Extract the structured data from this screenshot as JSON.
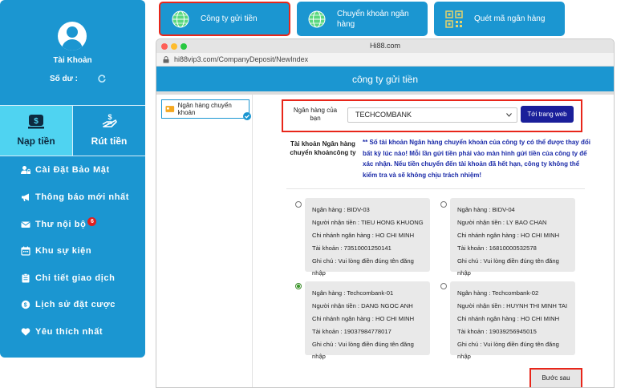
{
  "sidebar": {
    "account_label": "Tài Khoản",
    "balance_label": "Số dư :",
    "deposit_tab": "Nạp tiền",
    "withdraw_tab": "Rút tiền",
    "menu": [
      {
        "label": "Cài Đặt Bảo Mật",
        "icon": "user-lock-icon"
      },
      {
        "label": "Thông báo mới nhất",
        "icon": "megaphone-icon"
      },
      {
        "label": "Thư nội bộ",
        "icon": "envelope-icon",
        "badge": "6"
      },
      {
        "label": "Khu sự kiện",
        "icon": "calendar-icon"
      },
      {
        "label": "Chi tiết giao dịch",
        "icon": "clipboard-icon"
      },
      {
        "label": "Lịch sử đặt cược",
        "icon": "history-icon"
      },
      {
        "label": "Yêu thích nhất",
        "icon": "heart-icon"
      }
    ]
  },
  "methods": [
    {
      "label": "Công ty gửi tiền",
      "icon": "globe-icon",
      "selected": true
    },
    {
      "label": "Chuyển khoản ngân hàng",
      "icon": "globe-icon",
      "selected": false
    },
    {
      "label": "Quét mã ngân hàng",
      "icon": "qr-code-icon",
      "selected": false
    }
  ],
  "browser": {
    "window_title": "Hi88.com",
    "url": "hi88vip3.com/CompanyDeposit/NewIndex"
  },
  "page": {
    "header_title": "công ty gửi tiền",
    "bank_option_label": "Ngân hàng chuyển khoản",
    "your_bank_label": "Ngân hàng của bạn",
    "selected_bank": "TECHCOMBANK",
    "web_button": "Tới trang web",
    "company_account_label": "Tài khoản Ngân hàng chuyển khoảncông ty",
    "notice": "** Số tài khoản Ngân hàng chuyển khoản của công ty có thể được thay đổi bất kỳ lúc nào! Mỗi lần gửi tiền phải vào màn hình gửi tiền của công ty để xác nhận. Nếu tiền chuyển đến tài khoản đã hết hạn, công ty không thể kiểm tra và sẽ không chịu trách nhiệm!",
    "next_button": "Bước sau"
  },
  "accounts": [
    {
      "bank": "Ngân hàng : BIDV-03",
      "recipient": "Người nhận tiền : TIEU HONG KHUONG",
      "branch": "Chi nhánh ngân hàng : HO CHI MINH",
      "number": "Tài khoản : 73510001250141",
      "note": "Ghi chú : Vui lòng điền đúng tên đăng nhập",
      "selected": false
    },
    {
      "bank": "Ngân hàng : BIDV-04",
      "recipient": "Người nhận tiền : LY BAO CHAN",
      "branch": "Chi nhánh ngân hàng : HO CHI MINH",
      "number": "Tài khoản : 16810000532578",
      "note": "Ghi chú : Vui lòng điền đúng tên đăng nhập",
      "selected": false
    },
    {
      "bank": "Ngân hàng : Techcombank-01",
      "recipient": "Người nhận tiền : DANG NGOC ANH",
      "branch": "Chi nhánh ngân hàng : HO CHI MINH",
      "number": "Tài khoản : 19037984778017",
      "note": "Ghi chú : Vui lòng điền đúng tên đăng nhập",
      "selected": true
    },
    {
      "bank": "Ngân hàng : Techcombank-02",
      "recipient": "Người nhận tiền : HUYNH THI MINH TAI",
      "branch": "Chi nhánh ngân hàng : HO CHI MINH",
      "number": "Tài khoản : 19039256945015",
      "note": "Ghi chú : Vui lòng điền đúng tên đăng nhập",
      "selected": false
    }
  ],
  "colors": {
    "brand_blue": "#1b96d1",
    "active_tab": "#4fd3f1",
    "highlight_red": "#e8261a",
    "button_navy": "#1a1f9a",
    "notice_blue": "#1a2aa8"
  }
}
